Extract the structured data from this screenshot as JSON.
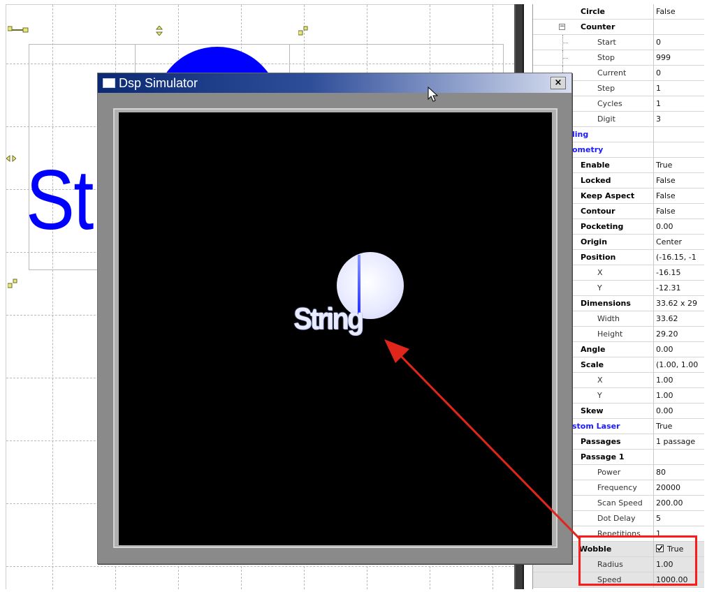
{
  "simulator": {
    "title": "Dsp Simulator",
    "close_label": "×",
    "preview_text": "String"
  },
  "canvas": {
    "big_text": "St"
  },
  "properties": {
    "rows": [
      {
        "name": "Circle",
        "value": "False",
        "style": "bold",
        "level": 1
      },
      {
        "name": "Counter",
        "value": "",
        "style": "bold",
        "level": 1,
        "expander": "−"
      },
      {
        "name": "Start",
        "value": "0",
        "style": "sub",
        "level": 2
      },
      {
        "name": "Stop",
        "value": "999",
        "style": "sub",
        "level": 2
      },
      {
        "name": "Current",
        "value": "0",
        "style": "sub",
        "level": 2
      },
      {
        "name": "Step",
        "value": "1",
        "style": "sub",
        "level": 2
      },
      {
        "name": "Cycles",
        "value": "1",
        "style": "sub",
        "level": 2
      },
      {
        "name": "Digit",
        "value": "3",
        "style": "sub",
        "level": 2
      },
      {
        "name": "ling",
        "value": "",
        "style": "cat",
        "level": 0
      },
      {
        "name": "ometry",
        "value": "",
        "style": "cat",
        "level": 0
      },
      {
        "name": "Enable",
        "value": "True",
        "style": "bold",
        "level": 1
      },
      {
        "name": "Locked",
        "value": "False",
        "style": "bold",
        "level": 1
      },
      {
        "name": "Keep Aspect",
        "value": "False",
        "style": "bold",
        "level": 1
      },
      {
        "name": "Contour",
        "value": "False",
        "style": "bold",
        "level": 1
      },
      {
        "name": "Pocketing",
        "value": "0.00",
        "style": "bold",
        "level": 1
      },
      {
        "name": "Origin",
        "value": "Center",
        "style": "bold",
        "level": 1
      },
      {
        "name": "Position",
        "value": "(-16.15, -1",
        "style": "bold",
        "level": 1
      },
      {
        "name": "X",
        "value": "-16.15",
        "style": "sub",
        "level": 2
      },
      {
        "name": "Y",
        "value": "-12.31",
        "style": "sub",
        "level": 2
      },
      {
        "name": "Dimensions",
        "value": "33.62 x 29",
        "style": "bold",
        "level": 1
      },
      {
        "name": "Width",
        "value": "33.62",
        "style": "sub",
        "level": 2
      },
      {
        "name": "Height",
        "value": "29.20",
        "style": "sub",
        "level": 2
      },
      {
        "name": "Angle",
        "value": "0.00",
        "style": "bold",
        "level": 1
      },
      {
        "name": "Scale",
        "value": "(1.00, 1.00",
        "style": "bold",
        "level": 1
      },
      {
        "name": "X",
        "value": "1.00",
        "style": "sub",
        "level": 2
      },
      {
        "name": "Y",
        "value": "1.00",
        "style": "sub",
        "level": 2
      },
      {
        "name": "Skew",
        "value": "0.00",
        "style": "bold",
        "level": 1
      },
      {
        "name": "stom Laser",
        "value": "True",
        "style": "cat",
        "level": 0
      },
      {
        "name": "Passages",
        "value": "1 passage",
        "style": "bold",
        "level": 1
      },
      {
        "name": "Passage 1",
        "value": "",
        "style": "bold",
        "level": 1
      },
      {
        "name": "Power",
        "value": "80",
        "style": "sub",
        "level": 2
      },
      {
        "name": "Frequency",
        "value": "20000",
        "style": "sub",
        "level": 2
      },
      {
        "name": "Scan Speed",
        "value": "200.00",
        "style": "sub",
        "level": 2
      },
      {
        "name": "Dot Delay",
        "value": "5",
        "style": "sub",
        "level": 2
      },
      {
        "name": "Repetitions",
        "value": "1",
        "style": "sub",
        "level": 2
      },
      {
        "name": "Wobble",
        "value": "True",
        "style": "bold",
        "level": 0,
        "checkbox": true,
        "checked": true,
        "gray": true
      },
      {
        "name": "Radius",
        "value": "1.00",
        "style": "sub",
        "level": 1,
        "gray": true
      },
      {
        "name": "Speed",
        "value": "1000.00",
        "style": "sub",
        "level": 1,
        "gray": true
      }
    ]
  },
  "colors": {
    "design_blue": "#0000ff",
    "highlight_red": "#ff1a1a",
    "annotation_arrow": "#e0261a"
  }
}
